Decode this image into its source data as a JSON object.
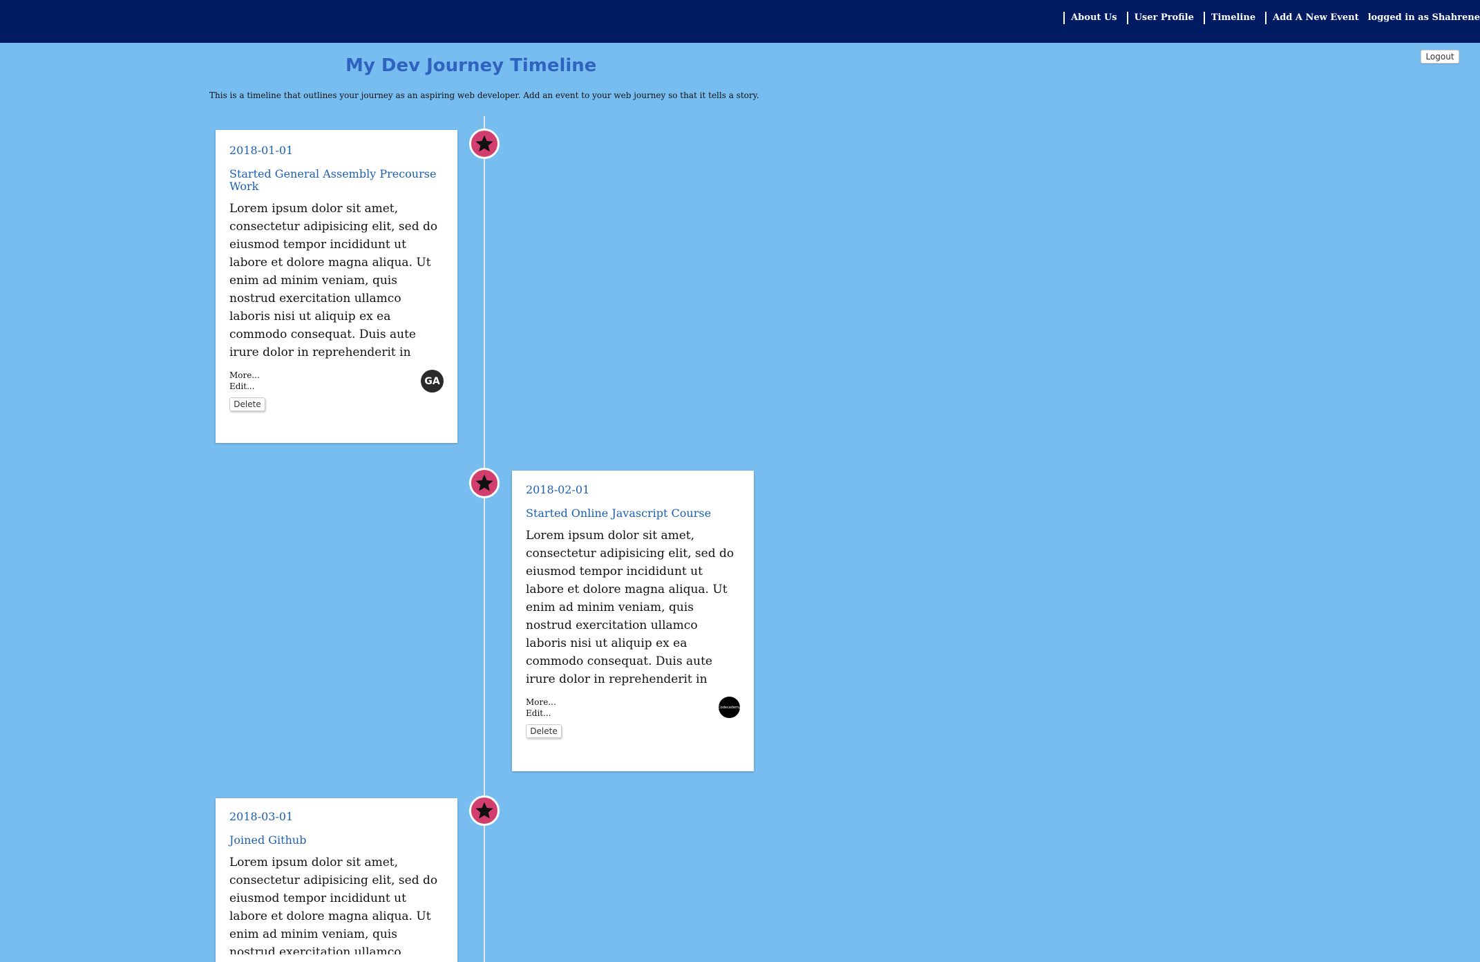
{
  "nav": {
    "links": [
      "About Us",
      "User Profile",
      "Timeline",
      "Add A New Event"
    ],
    "logged_in": "logged in as Shahrene"
  },
  "logout_label": "Logout",
  "page": {
    "title": "My Dev Journey Timeline",
    "subtitle": "This is a timeline that outlines your journey as an aspiring web developer. Add an event to your web journey so that it tells a story."
  },
  "events": [
    {
      "date": "2018-01-01",
      "title": "Started General Assembly Precourse Work",
      "body": "Lorem ipsum dolor sit amet, consectetur adipisicing elit, sed do eiusmod tempor incididunt ut labore et dolore magna aliqua. Ut enim ad minim veniam, quis nostrud exercitation ullamco laboris nisi ut aliquip ex ea commodo consequat. Duis aute irure dolor in reprehenderit in voluptate velit esse",
      "more": "More...",
      "edit": "Edit...",
      "delete": "Delete",
      "logo_text": "GA",
      "icon": "star-icon"
    },
    {
      "date": "2018-02-01",
      "title": "Started Online Javascript Course",
      "body": "Lorem ipsum dolor sit amet, consectetur adipisicing elit, sed do eiusmod tempor incididunt ut labore et dolore magna aliqua. Ut enim ad minim veniam, quis nostrud exercitation ullamco laboris nisi ut aliquip ex ea commodo consequat. Duis aute irure dolor in reprehenderit in voluptate velit esse",
      "more": "More...",
      "edit": "Edit...",
      "delete": "Delete",
      "logo_text": "Codecademy",
      "icon": "star-icon"
    },
    {
      "date": "2018-03-01",
      "title": "Joined Github",
      "body": "Lorem ipsum dolor sit amet, consectetur adipisicing elit, sed do eiusmod tempor incididunt ut labore et dolore magna aliqua. Ut enim ad minim veniam, quis nostrud exercitation ullamco laboris nisi ut aliquip ex ea commodo consequat. Duis aute irure dolor in reprehenderit in voluptate velit esse",
      "icon": "star-icon"
    }
  ],
  "colors": {
    "background": "#78bdf0",
    "topbar": "#001b62",
    "accent_text": "#1d5fb0",
    "marker": "#d23e6d"
  }
}
